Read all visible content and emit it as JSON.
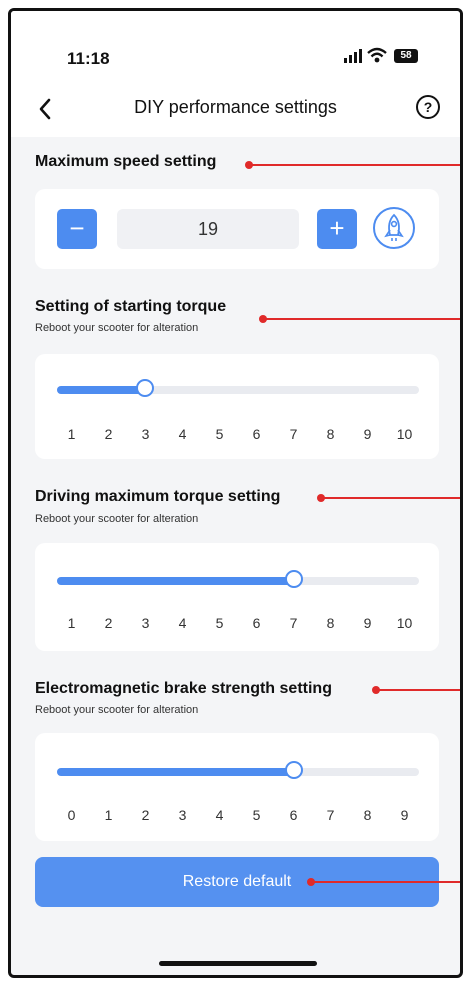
{
  "status_bar": {
    "time": "11:18",
    "battery": "58"
  },
  "nav": {
    "title": "DIY performance settings",
    "help_symbol": "?"
  },
  "max_speed": {
    "title": "Maximum speed setting",
    "value": "19",
    "minus_label": "−",
    "plus_label": "+",
    "mode_icon": "rocket-icon"
  },
  "starting_torque": {
    "title": "Setting of starting torque",
    "subtitle": "Reboot your scooter for alteration",
    "ticks": [
      "1",
      "2",
      "3",
      "4",
      "5",
      "6",
      "7",
      "8",
      "9",
      "10"
    ],
    "value": 3
  },
  "driving_torque": {
    "title": "Driving maximum torque setting",
    "subtitle": "Reboot your scooter for alteration",
    "ticks": [
      "1",
      "2",
      "3",
      "4",
      "5",
      "6",
      "7",
      "8",
      "9",
      "10"
    ],
    "value": 7
  },
  "brake_strength": {
    "title": "Electromagnetic brake strength setting",
    "subtitle": "Reboot your scooter for alteration",
    "ticks": [
      "0",
      "1",
      "2",
      "3",
      "4",
      "5",
      "6",
      "7",
      "8",
      "9"
    ],
    "value": 6
  },
  "restore_label": "Restore default",
  "colors": {
    "accent": "#4d8cf0",
    "callout": "#e02a2a",
    "background": "#f4f5f7"
  }
}
